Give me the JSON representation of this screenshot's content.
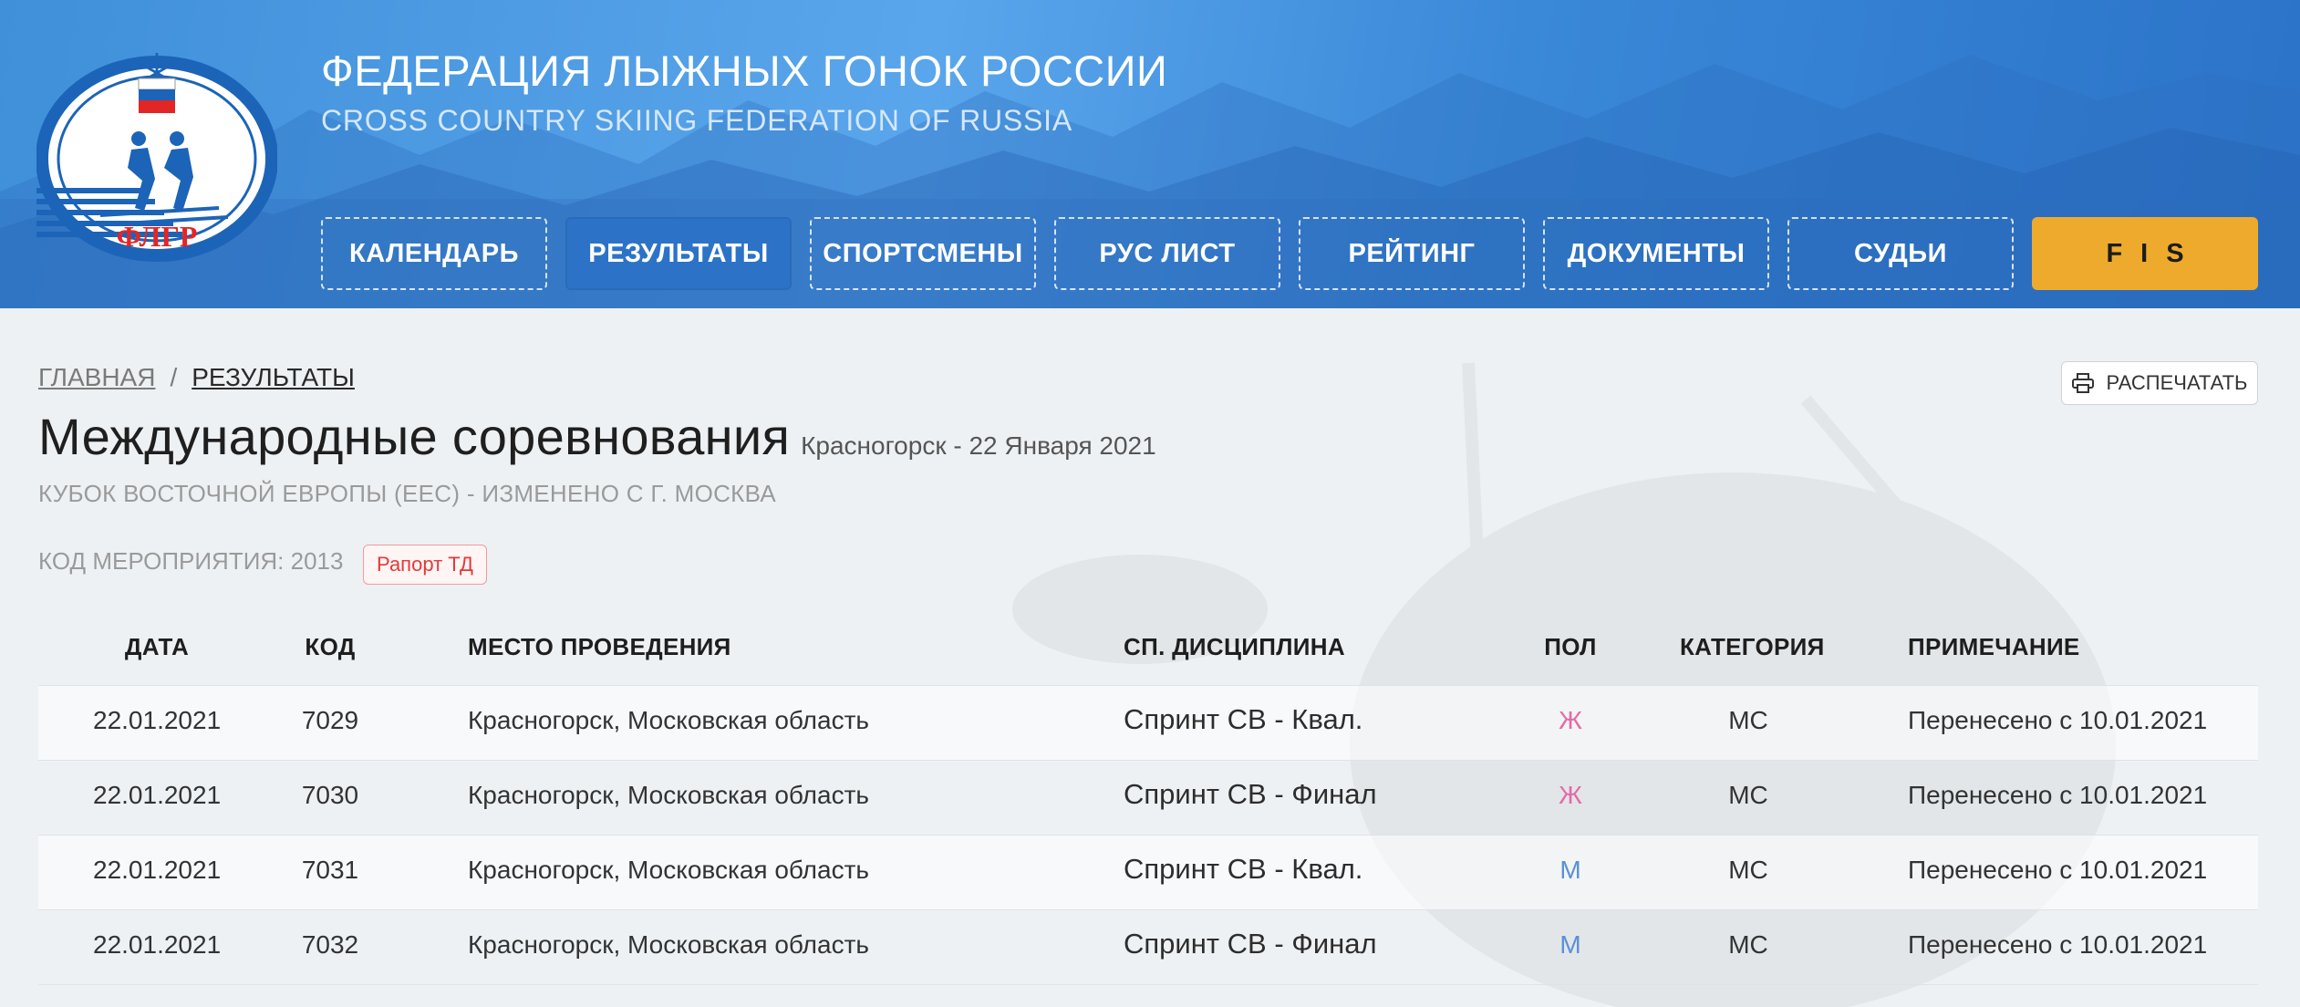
{
  "header": {
    "title": "ФЕДЕРАЦИЯ ЛЫЖНЫХ ГОНОК РОССИИ",
    "subtitle": "CROSS COUNTRY SKIING FEDERATION OF RUSSIA",
    "logo_text": "ФЛГР",
    "logo_icon": "flgr-logo"
  },
  "nav": [
    {
      "label": "КАЛЕНДАРЬ",
      "active": false
    },
    {
      "label": "РЕЗУЛЬТАТЫ",
      "active": true
    },
    {
      "label": "СПОРТСМЕНЫ",
      "active": false
    },
    {
      "label": "РУС ЛИСТ",
      "active": false
    },
    {
      "label": "РЕЙТИНГ",
      "active": false
    },
    {
      "label": "ДОКУМЕНТЫ",
      "active": false
    },
    {
      "label": "СУДЬИ",
      "active": false
    },
    {
      "label": "FIS",
      "active": false
    }
  ],
  "breadcrumb": {
    "home": "ГЛАВНАЯ",
    "separator": "/",
    "current": "РЕЗУЛЬТАТЫ"
  },
  "print_button": {
    "label": "РАСПЕЧАТАТЬ",
    "icon": "printer-icon"
  },
  "event": {
    "title": "Международные соревнования",
    "location_date": "Красногорск - 22 Января 2021",
    "cup": "КУБОК ВОСТОЧНОЙ ЕВРОПЫ (EEC) - ИЗМЕНЕНО С Г. МОСКВА",
    "code_label": "КОД МЕРОПРИЯТИЯ: 2013",
    "report_label": "Рапорт ТД"
  },
  "table": {
    "headers": {
      "date": "ДАТА",
      "code": "КОД",
      "place": "МЕСТО ПРОВЕДЕНИЯ",
      "discipline": "СП. ДИСЦИПЛИНА",
      "sex": "ПОЛ",
      "category": "КАТЕГОРИЯ",
      "note": "ПРИМЕЧАНИЕ"
    },
    "rows": [
      {
        "date": "22.01.2021",
        "code": "7029",
        "place": "Красногорск, Московская область",
        "discipline": "Спринт СВ - Квал.",
        "sex": "Ж",
        "category": "МС",
        "note": "Перенесено с 10.01.2021"
      },
      {
        "date": "22.01.2021",
        "code": "7030",
        "place": "Красногорск, Московская область",
        "discipline": "Спринт СВ - Финал",
        "sex": "Ж",
        "category": "МС",
        "note": "Перенесено с 10.01.2021"
      },
      {
        "date": "22.01.2021",
        "code": "7031",
        "place": "Красногорск, Московская область",
        "discipline": "Спринт СВ - Квал.",
        "sex": "М",
        "category": "МС",
        "note": "Перенесено с 10.01.2021"
      },
      {
        "date": "22.01.2021",
        "code": "7032",
        "place": "Красногорск, Московская область",
        "discipline": "Спринт СВ - Финал",
        "sex": "М",
        "category": "МС",
        "note": "Перенесено с 10.01.2021"
      }
    ]
  },
  "colors": {
    "header_blue": "#3f8fd9",
    "nav_active": "#2c73c7",
    "fis_button": "#eeaa2c",
    "female": "#e46aa8",
    "male": "#5b8fd6",
    "report_red": "#e53838"
  }
}
